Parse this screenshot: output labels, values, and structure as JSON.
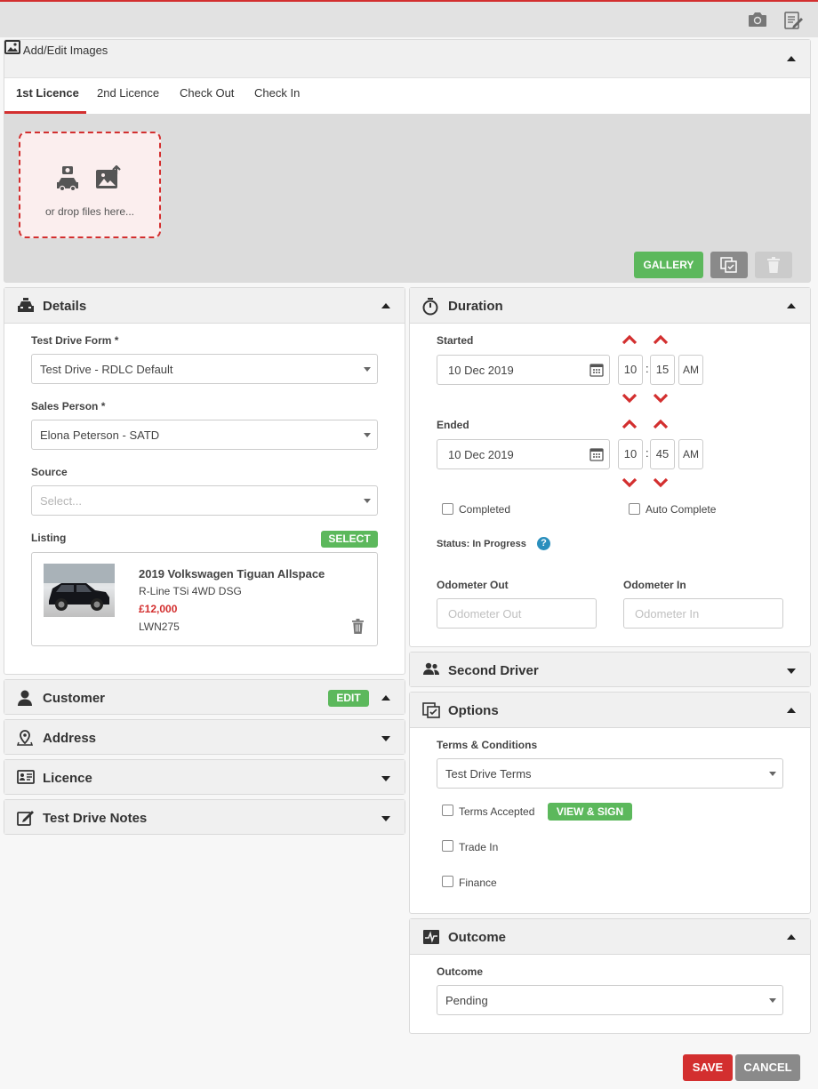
{
  "images": {
    "title": "Add/Edit Images",
    "tabs": [
      "1st Licence",
      "2nd Licence",
      "Check Out",
      "Check In"
    ],
    "active_tab": "1st Licence",
    "drop_text": "or drop files here...",
    "gallery_label": "GALLERY"
  },
  "details": {
    "title": "Details",
    "form_label": "Test Drive Form *",
    "form_value": "Test Drive - RDLC Default",
    "sales_label": "Sales Person *",
    "sales_value": "Elona Peterson - SATD",
    "source_label": "Source",
    "source_placeholder": "Select...",
    "listing_label": "Listing",
    "select_label": "SELECT",
    "listing": {
      "title": "2019 Volkswagen Tiguan Allspace",
      "variant": "R-Line TSi 4WD DSG",
      "price": "£12,000",
      "reg": "LWN275"
    }
  },
  "customer": {
    "title": "Customer",
    "edit_label": "EDIT"
  },
  "address": {
    "title": "Address"
  },
  "licence": {
    "title": "Licence"
  },
  "notes": {
    "title": "Test Drive Notes"
  },
  "duration": {
    "title": "Duration",
    "started_label": "Started",
    "started_date": "10 Dec 2019",
    "started_hour": "10",
    "started_min": "15",
    "started_ampm": "AM",
    "ended_label": "Ended",
    "ended_date": "10 Dec 2019",
    "ended_hour": "10",
    "ended_min": "45",
    "ended_ampm": "AM",
    "time_sep": ":",
    "completed_label": "Completed",
    "auto_complete_label": "Auto Complete",
    "status": "Status: In Progress",
    "help": "?",
    "odo_out_label": "Odometer Out",
    "odo_out_placeholder": "Odometer Out",
    "odo_in_label": "Odometer In",
    "odo_in_placeholder": "Odometer In"
  },
  "second_driver": {
    "title": "Second Driver"
  },
  "options": {
    "title": "Options",
    "terms_label": "Terms & Conditions",
    "terms_value": "Test Drive Terms",
    "terms_accepted_label": "Terms Accepted",
    "view_sign_label": "VIEW & SIGN",
    "trade_in_label": "Trade In",
    "finance_label": "Finance"
  },
  "outcome": {
    "title": "Outcome",
    "outcome_label": "Outcome",
    "outcome_value": "Pending"
  },
  "footer": {
    "save_label": "SAVE",
    "cancel_label": "CANCEL"
  },
  "colors": {
    "accent_red": "#d32f2f",
    "green": "#5cb85c",
    "grey_button": "#8a8a8a",
    "help_blue": "#2a8fbd"
  }
}
